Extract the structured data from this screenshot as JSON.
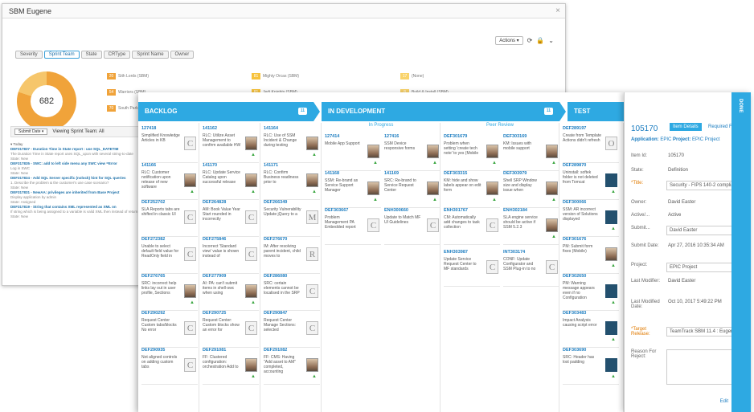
{
  "window": {
    "title": "SBM Eugene",
    "close": "×"
  },
  "actions": {
    "label": "Actions ▾",
    "refresh": "⟳",
    "lock": "🔒",
    "more": "⌄"
  },
  "tabs": [
    "Severity",
    "Sprint Team",
    "State",
    "CRType",
    "Sprint Name",
    "Owner"
  ],
  "donut": {
    "total": "682"
  },
  "legend": [
    {
      "n": "20",
      "label": "Sith Lords (SBM)",
      "color": "#f0a33a"
    },
    {
      "n": "81",
      "label": "Mighty Orcas (SBM)",
      "color": "#f7c23b"
    },
    {
      "n": "17",
      "label": "(None)",
      "color": "#f9d36a"
    },
    {
      "n": "54",
      "label": "Warriors (SBM)",
      "color": "#f0a33a"
    },
    {
      "n": "81",
      "label": "Jedi Knights (SBM)",
      "color": "#f7c23b"
    },
    {
      "n": "8",
      "label": "Build & Install (SBM)",
      "color": "#f9d36a"
    },
    {
      "n": "70",
      "label": "South Park",
      "color": "#f0a33a"
    }
  ],
  "feed": {
    "button": "Submit Date ▾",
    "viewing": "Viewing Sprint Team: All",
    "today": "▾ Today",
    "items": [
      {
        "k": "DEF317837 - Duration Time in State report : use SQL_DATETIM",
        "s": "The Duration Time in State report uses SQL_upon with several string-to-date",
        "t": "State: New"
      },
      {
        "k": "DEF317835 - SWC: add to left side menu any SWC view =Error",
        "s": "Log in SWC",
        "t": "State: New"
      },
      {
        "k": "DEF317834 - Add SQL Server specific (nolock) hint for SQL queries",
        "s": "1. Describe the problem & the customer's use case scenario?",
        "t": "State: New"
      },
      {
        "k": "DEF317831 - NewAA: privileges are inherited from Base Project",
        "s": "Display application by admin",
        "t": "State: Assigned"
      },
      {
        "k": "DEF317819 - String that contains XML represented as XML on",
        "s": "If string which is being assigned to a variable is valid XML then instead of return",
        "t": "State: New"
      }
    ]
  },
  "stages": {
    "backlog": "BACKLOG",
    "dev": "IN DEVELOPMENT",
    "test": "TEST",
    "done": "DONE",
    "backlog_count": "11",
    "dev_count": "11",
    "test_count": "11"
  },
  "subheads": {
    "progress": "In Progress",
    "review": "Peer Review"
  },
  "cards": [
    {
      "id": "127418",
      "t": "Simplified Knowledge Articles in KB",
      "a": "C"
    },
    {
      "id": "141162",
      "t": "RLC: Utilize Asset Management to confirm available HW",
      "a": "ph"
    },
    {
      "id": "141164",
      "t": "RLC: Use of SSM Incident & Change during testing",
      "a": "ph"
    },
    {
      "id": "141166",
      "t": "RLC: Customer notification upon release of new software",
      "a": "ph"
    },
    {
      "id": "141170",
      "t": "RLC: Update Service Catalog upon successful release",
      "a": "ph"
    },
    {
      "id": "141171",
      "t": "RLC: Confirm Business readiness prior to",
      "a": "ph"
    },
    {
      "id": "DEF252702",
      "t": "SLA Reports tabs are shifted in classic UI",
      "a": "C"
    },
    {
      "id": "DEF264828",
      "t": "AM: Book Value Year Start rounded in incorrectly",
      "a": "C"
    },
    {
      "id": "DEF266349",
      "t": "Security Vulnerability Update jQuery to a",
      "a": "M"
    },
    {
      "id": "DEF272382",
      "t": "Unable to select default field value for ReadOnly field in",
      "a": "C"
    },
    {
      "id": "DEF275846",
      "t": "Incorrect 'Standard view' value is shown instead of",
      "a": "C"
    },
    {
      "id": "DEF276670",
      "t": "IM: After resolving parent incident, child moves to",
      "a": "R"
    },
    {
      "id": "DEF276765",
      "t": "SRC: incorrect help links lay out in user profile, Sections",
      "a": "ph"
    },
    {
      "id": "DEF277909",
      "t": "AI: PA: can't submit items in shell-swc when using",
      "a": "ph"
    },
    {
      "id": "DEF286080",
      "t": "SRC: certain elements cannot be localised in the SRP",
      "a": "C"
    },
    {
      "id": "DEF290292",
      "t": "Request Center Custom tabs/blocks No error",
      "a": "C"
    },
    {
      "id": "DEF290725",
      "t": "Request Center: Custom blocks show an error for",
      "a": "C"
    },
    {
      "id": "DEF290847",
      "t": "Request Center Manage Sections: selected",
      "a": "C"
    },
    {
      "id": "DEF290935",
      "t": "Not aligned controls on adding custom tabs",
      "a": "C"
    },
    {
      "id": "DEF291081",
      "t": "FF: Clustered configuration: orchestration Add to",
      "a": "ph"
    },
    {
      "id": "DEF291082",
      "t": "FF: CMS: Having \"Add asset to AM\" completed, accounting",
      "a": "ph"
    },
    {
      "id": "127414",
      "t": "Mobile App Support",
      "a": "ph"
    },
    {
      "id": "127416",
      "t": "SSM Device responsive forms",
      "a": "ph"
    },
    {
      "id": "141168",
      "t": "SSM: Re-brand as Service Support Manager",
      "a": "ph"
    },
    {
      "id": "141169",
      "t": "SRC: Re-brand to Service Request Center",
      "a": "ph"
    },
    {
      "id": "DEF303667",
      "t": "Problem Management PA Embedded report",
      "a": "C"
    },
    {
      "id": "ENH300660",
      "t": "Update to Match MF UI Guidelines",
      "a": "C"
    },
    {
      "id": "DEF301679",
      "t": "Problem when setting 'create tech note' to yes (Mobile",
      "a": "ph"
    },
    {
      "id": "DEF303169",
      "t": "KM: Issues with mobile support",
      "a": "ph"
    },
    {
      "id": "DEF303315",
      "t": "KM: hide and show labels appear on edit form",
      "a": "ph"
    },
    {
      "id": "DEF303979",
      "t": "Shell SRP Window size and display issue when",
      "a": "ph"
    },
    {
      "id": "ENH301767",
      "t": "CM: Automatically add changes to task collection",
      "a": "C"
    },
    {
      "id": "ENH302184",
      "t": "SLA engine service should be active if SSM 5.2.3",
      "a": "ph"
    },
    {
      "id": "ENH303987",
      "t": "Update Service Request Center to MF standards",
      "a": "C"
    },
    {
      "id": "INT303174",
      "t": "CONF: Update Configurator and SSM Plug-in to no",
      "a": "C"
    },
    {
      "id": "DEF289197",
      "t": "Create from Template Actions didn't refresh",
      "a": "O"
    },
    {
      "id": "DEF289870",
      "t": "Uninstall: softek folder is not deleted from Tomcat",
      "a": "bl"
    },
    {
      "id": "DEF300066",
      "t": "SSM: AR incorrect version of Solutions displayed",
      "a": "bl"
    },
    {
      "id": "DEF301676",
      "t": "PM: Submit form fixes (Mobile)",
      "a": "ph"
    },
    {
      "id": "DEF302650",
      "t": "PM: Warning message appears even if no Configuration",
      "a": "bl"
    },
    {
      "id": "DEF303483",
      "t": "Impact Analysis causing script error",
      "a": "bl"
    },
    {
      "id": "DEF303690",
      "t": "SRC: Header has lost padding",
      "a": "bl"
    }
  ],
  "detail": {
    "id": "105170",
    "tab1": "Item Details",
    "tab2": "Required Fields",
    "close": "×",
    "app_prefix": "Application:",
    "app": "EPIC",
    "proj_prefix": "Project:",
    "proj": "EPIC Project",
    "item_id_l": "Item Id:",
    "item_id": "105170",
    "state_l": "State:",
    "state": "Definition",
    "title_l": "*Title:",
    "title": "Security - FIPS 140-2 compliance",
    "owner_l": "Owner:",
    "owner": "David Easter",
    "active_l": "Active/...",
    "active": "Active",
    "submit_l": "Submit...",
    "submit": "David Easter",
    "submit_date_l": "Submit Date:",
    "submit_date": "Apr 27, 2016 10:35:34 AM",
    "project_l": "Project:",
    "project": "EPIC Project",
    "lastmod_l": "Last Modifier:",
    "lastmod": "David Easter",
    "lastmodd_l": "Last Modified Date:",
    "lastmodd": "Oct 10, 2017 5:49:22 PM",
    "target_l": "*Target Release:",
    "target": "TeamTrack SBM 11.4 : Eugene",
    "reason_l": "Reason For Reject:",
    "edit": "Edit"
  }
}
